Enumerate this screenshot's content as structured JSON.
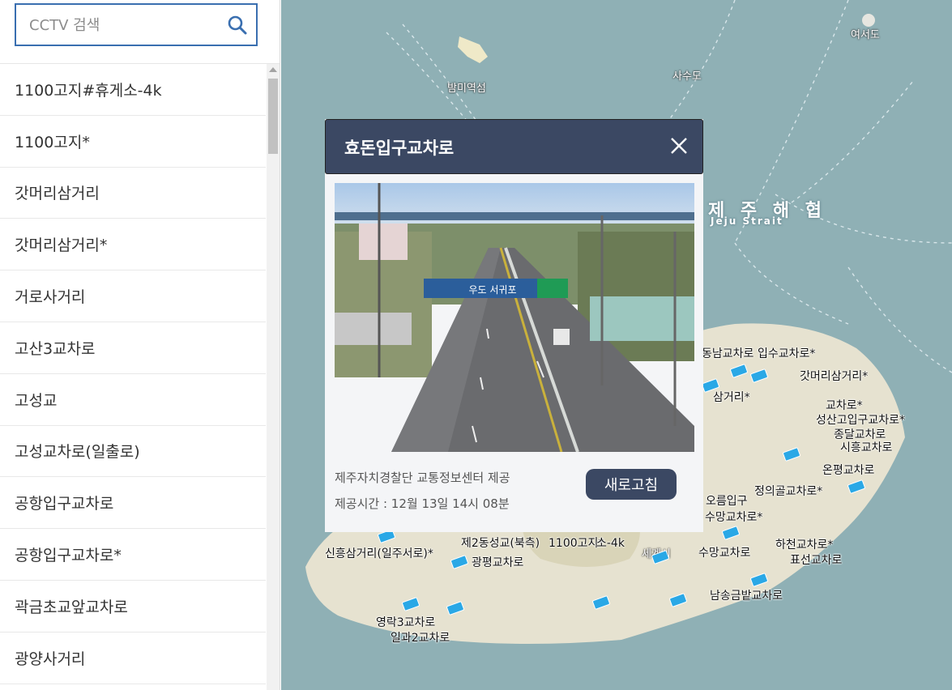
{
  "search": {
    "placeholder": "CCTV 검색"
  },
  "cctv_list": [
    "1100고지#휴게소-4k",
    "1100고지*",
    "갓머리삼거리",
    "갓머리삼거리*",
    "거로사거리",
    "고산3교차로",
    "고성교",
    "고성교차로(일출로)",
    "공항입구교차로",
    "공항입구교차로*",
    "곽금초교앞교차로",
    "광양사거리"
  ],
  "map": {
    "places": [
      "여서도",
      "사수도",
      "밤미역섬",
      "세계시"
    ],
    "strait": {
      "ko": "제 주 해 협",
      "en": "Jeju Strait"
    },
    "roads": [
      "동남교차로",
      "입수교차로*",
      "갓머리삼거리*",
      "종달교차로",
      "시흥교차로",
      "온평교차로",
      "정의골교차로*",
      "수망교차로*",
      "하천교차로*",
      "수망교차로",
      "남송금밭교차로",
      "광평교차로",
      "제2동성교(북측)",
      "1100고지*",
      "소-4k",
      "신흥삼거리(일주서로)*",
      "영락3교차로",
      "일과2교차로",
      "오름입구",
      "성산고입구교차로*",
      "표선교차로",
      "교차로*",
      "삼거리*"
    ]
  },
  "popup": {
    "title": "효돈입구교차로",
    "source": "제주자치경찰단 교통정보센터 제공",
    "time": "제공시간 : 12월 13일 14시 08분",
    "refresh_label": "새로고침",
    "camera_sign": "우도 서귀포"
  },
  "colors": {
    "header": "#3b4863",
    "accent": "#3a6fb0",
    "camera": "#2aa8e6",
    "sea": "#8fb0b5",
    "land": "#e6e2d0"
  }
}
